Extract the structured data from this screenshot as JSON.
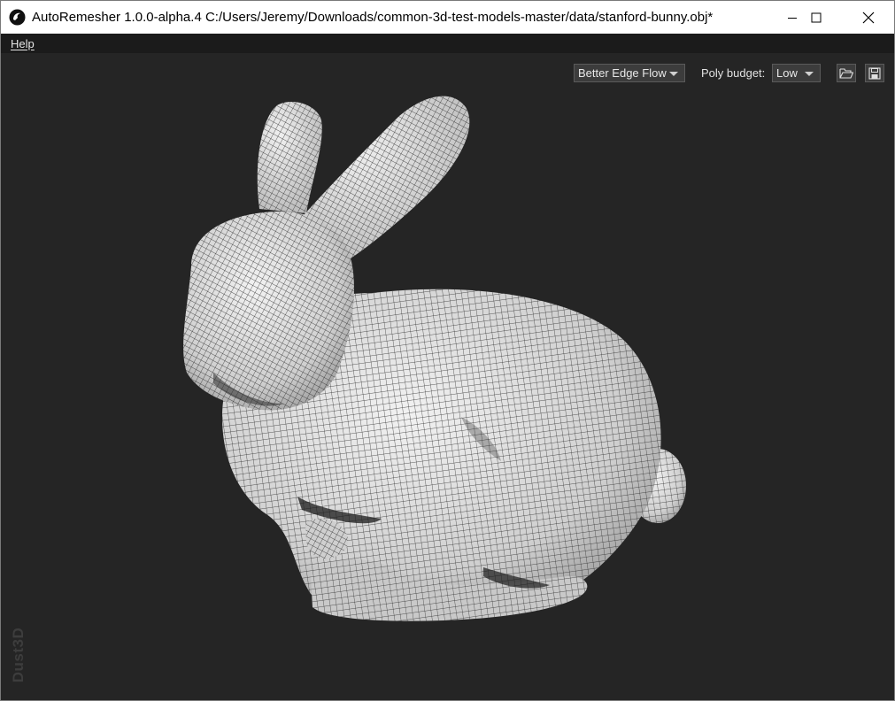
{
  "window": {
    "title": "AutoRemesher 1.0.0-alpha.4 C:/Users/Jeremy/Downloads/common-3d-test-models-master/data/stanford-bunny.obj*"
  },
  "menu": {
    "help": "Help"
  },
  "toolbar": {
    "remesh_mode": "Better Edge Flow",
    "poly_budget_label": "Poly budget:",
    "poly_budget_value": "Low"
  },
  "viewport": {
    "watermark": "Dust3D"
  },
  "colors": {
    "background": "#252525",
    "mesh_surface": "#d9d9d9",
    "wireframe": "#2a2a2a"
  }
}
